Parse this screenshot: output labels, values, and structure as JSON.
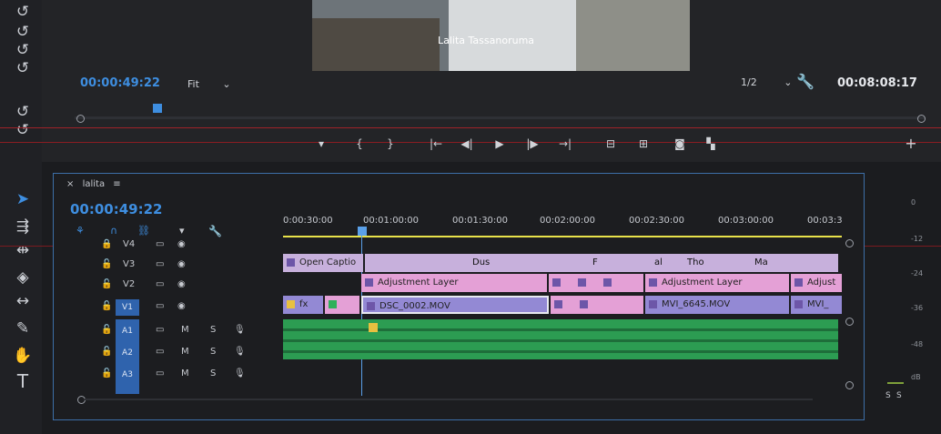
{
  "monitor": {
    "timecode_current": "00:00:49:22",
    "fit_label": "Fit",
    "resolution": "1/2",
    "timecode_duration": "00:08:08:17",
    "caption_text": "Lalita Tassanoruma"
  },
  "timeline": {
    "sequence_name": "lalita",
    "timecode": "00:00:49:22",
    "ruler": [
      "0:00:30:00",
      "00:01:00:00",
      "00:01:30:00",
      "00:02:00:00",
      "00:02:30:00",
      "00:03:00:00",
      "00:03:3"
    ],
    "tracks": {
      "video": [
        {
          "label": "V4"
        },
        {
          "label": "V3"
        },
        {
          "label": "V2"
        },
        {
          "label": "V1"
        }
      ],
      "audio": [
        {
          "label": "A1",
          "m": "M",
          "s": "S"
        },
        {
          "label": "A2",
          "m": "M",
          "s": "S"
        },
        {
          "label": "A3",
          "m": "M",
          "s": "S"
        }
      ]
    },
    "clips": {
      "v3_open_caption": "Open Captio",
      "v3_dus": "Dus",
      "v3_f": "F",
      "v3_al": "al",
      "v3_tho": "Tho",
      "v3_ma": "Ma",
      "v2_adjustment_1": "Adjustment Layer",
      "v2_adjustment_2": "Adjustment Layer",
      "v2_adjustment_3": "Adjust",
      "v1_dsc": "DSC_0002.MOV",
      "v1_mvi_1": "MVI_6645.MOV",
      "v1_mvi_2": "MVI_",
      "v1_fx": "fx"
    }
  },
  "meters": {
    "db_labels": [
      "0",
      "-12",
      "-24",
      "-36",
      "-48",
      "dB"
    ],
    "solo_labels": [
      "S",
      "S"
    ]
  },
  "colors": {
    "accent_blue": "#3e8ee0",
    "playhead": "#5aa0e8",
    "adjustment_clip": "#e4a0d6",
    "video_clip": "#9389d4",
    "audio_clip": "#2fb05a",
    "work_area_bar": "#e8e24a"
  }
}
